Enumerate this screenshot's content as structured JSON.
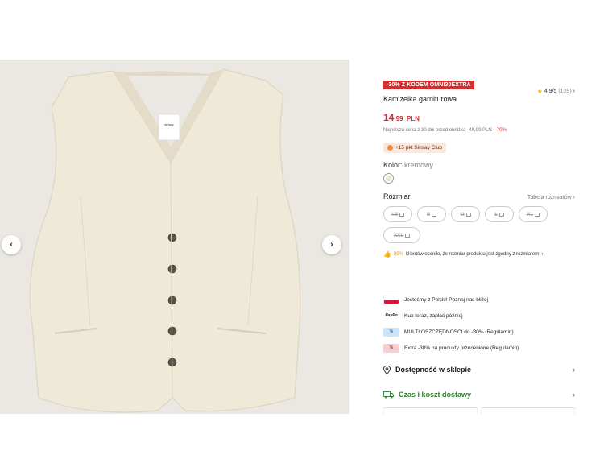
{
  "product": {
    "promo_badge": "-30% Z KODEM OMNI30EXTRA",
    "rating_value": "4,9/5",
    "rating_count": "(109)",
    "title": "Kamizelka garniturowa",
    "price_main": "14",
    "price_cents": ",99",
    "price_currency": "PLN",
    "lowest_label": "Najniższa cena z 30 dni przed obniżką",
    "lowest_old": "49,99 PLN",
    "lowest_discount": "-70%",
    "club_points": "+15 pkt Sinsay Club",
    "color_label": "Kolor:",
    "color_value": "kremowy",
    "size_label": "Rozmiar",
    "size_table": "Tabela rozmiarów",
    "sizes": [
      "XS",
      "S",
      "M",
      "L",
      "XL",
      "XXL"
    ],
    "fit_percent": "89%",
    "fit_text": "klientów oceniło, że rozmiar produktu jest zgodny z rozmiarem",
    "tag_text": "sinsay"
  },
  "features": [
    {
      "icon": "poland-flag-icon",
      "text": "Jesteśmy z Polski! Poznaj nas bliżej"
    },
    {
      "icon": "paypo-icon",
      "icon_text": "PayPo",
      "text": "Kup teraz, zapłać później"
    },
    {
      "icon": "multi-savings-icon",
      "text": "MULTI OSZCZĘDNOŚCI do -30% (Regulamin)"
    },
    {
      "icon": "extra-discount-icon",
      "text": "Extra -30% na produkty przecenione (Regulamin)"
    }
  ],
  "sections": {
    "store": "Dostępność w sklepie",
    "shipping": "Czas i koszt dostawy"
  },
  "colors": {
    "accent_red": "#e0282b",
    "promo_red": "#d32f2f",
    "green": "#2e7d32",
    "vest": "#efe9d8"
  }
}
